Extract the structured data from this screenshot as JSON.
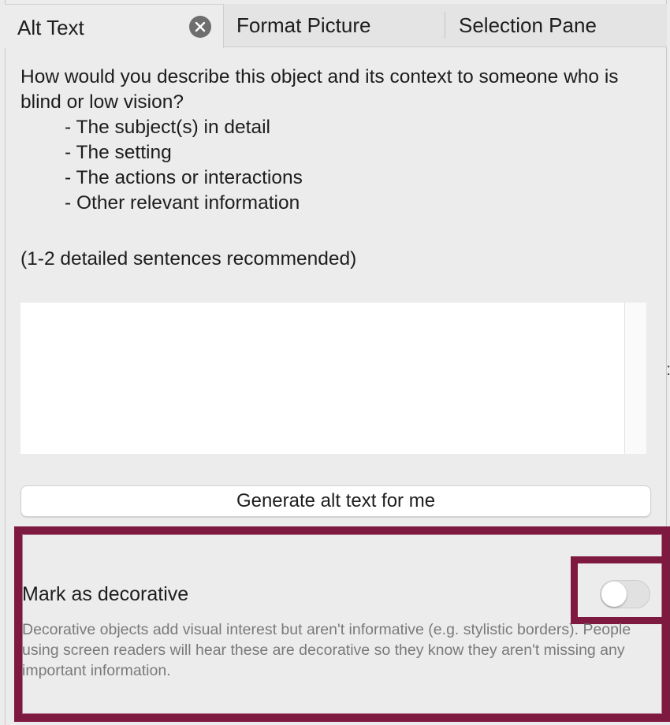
{
  "tabs": [
    {
      "label": "Alt Text",
      "active": true
    },
    {
      "label": "Format Picture",
      "active": false
    },
    {
      "label": "Selection Pane",
      "active": false
    }
  ],
  "prompt": {
    "question": "How would you describe this object and its context to someone who is blind or low vision?",
    "bullets": [
      "- The subject(s) in detail",
      "- The setting",
      "- The actions or interactions",
      "- Other relevant information"
    ],
    "recommendation": "(1-2 detailed sentences recommended)"
  },
  "alt_text_value": "",
  "generate_button_label": "Generate alt text for me",
  "decorative": {
    "title": "Mark as decorative",
    "checked": false,
    "description": "Decorative objects add visual interest but aren't informative (e.g. stylistic borders). People using screen readers will hear these are decorative so they know they aren't missing any important information."
  },
  "colors": {
    "highlight_frame": "#7e1a3f",
    "panel_background": "#ececec",
    "close_icon_bg": "#6e6e6e"
  },
  "icons": {
    "tab_close": "close-icon"
  }
}
